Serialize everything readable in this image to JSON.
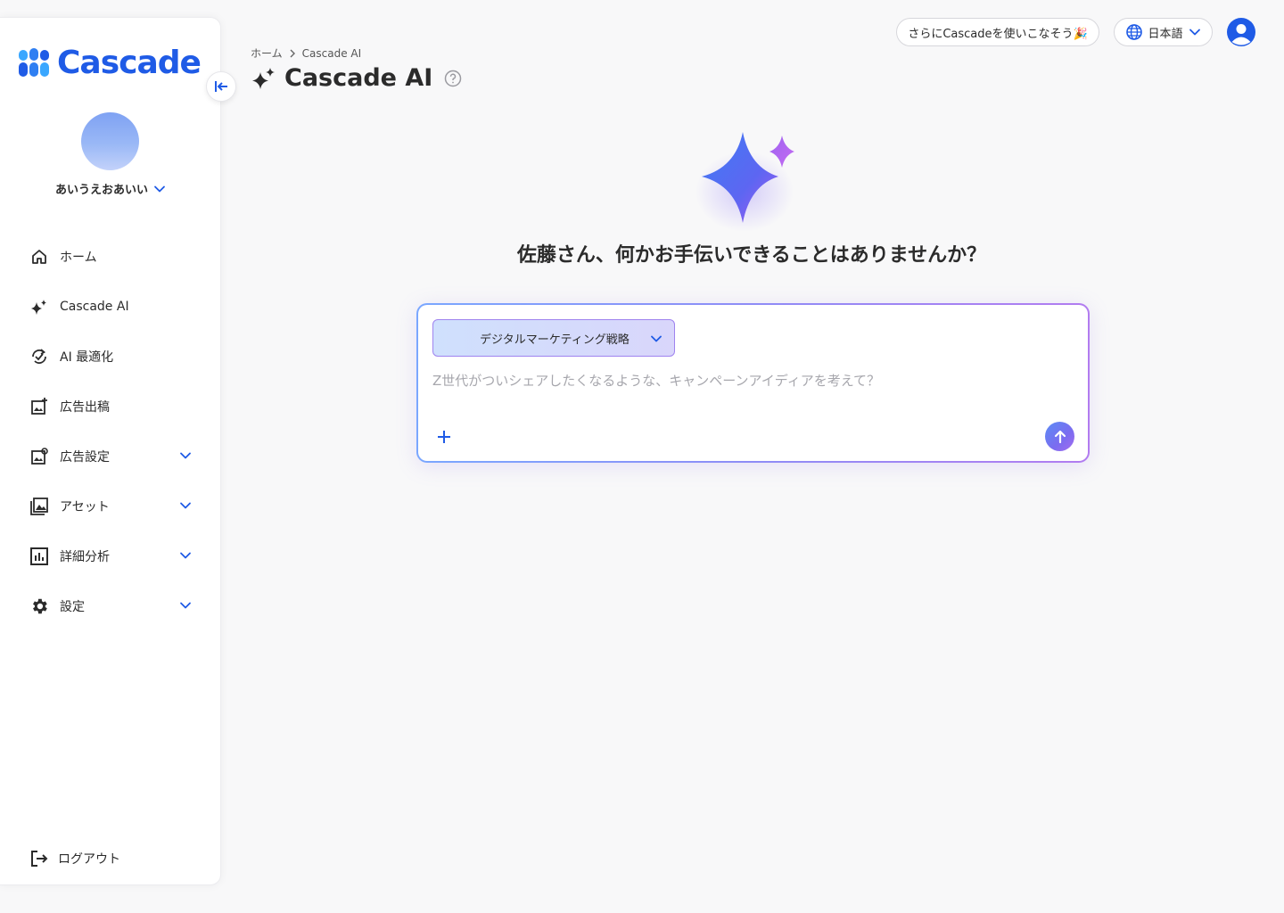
{
  "brand": {
    "name": "Cascade",
    "color": "#1f5be6"
  },
  "sidebar": {
    "account_name": "あいうえおあいい",
    "items": [
      {
        "label": "ホーム",
        "icon": "home-icon",
        "expandable": false
      },
      {
        "label": "Cascade AI",
        "icon": "sparkle-icon",
        "expandable": false
      },
      {
        "label": "AI 最適化",
        "icon": "ai-optimize-icon",
        "expandable": false
      },
      {
        "label": "広告出稿",
        "icon": "ad-publish-icon",
        "expandable": false
      },
      {
        "label": "広告設定",
        "icon": "ad-settings-icon",
        "expandable": true
      },
      {
        "label": "アセット",
        "icon": "image-gallery-icon",
        "expandable": true
      },
      {
        "label": "詳細分析",
        "icon": "analytics-icon",
        "expandable": true
      },
      {
        "label": "設定",
        "icon": "gear-icon",
        "expandable": true
      }
    ],
    "logout_label": "ログアウト"
  },
  "header": {
    "breadcrumb": [
      "ホーム",
      "Cascade AI"
    ],
    "title": "Cascade AI",
    "promo_label": "さらにCascadeを使いこなそう🎉",
    "language_label": "日本語"
  },
  "main": {
    "greeting": "佐藤さん、何かお手伝いできることはありませんか？",
    "mode_select_value": "デジタルマーケティング戦略",
    "prompt_placeholder": "Z世代がついシェアしたくなるような、キャンペーンアイディアを考えて？"
  }
}
